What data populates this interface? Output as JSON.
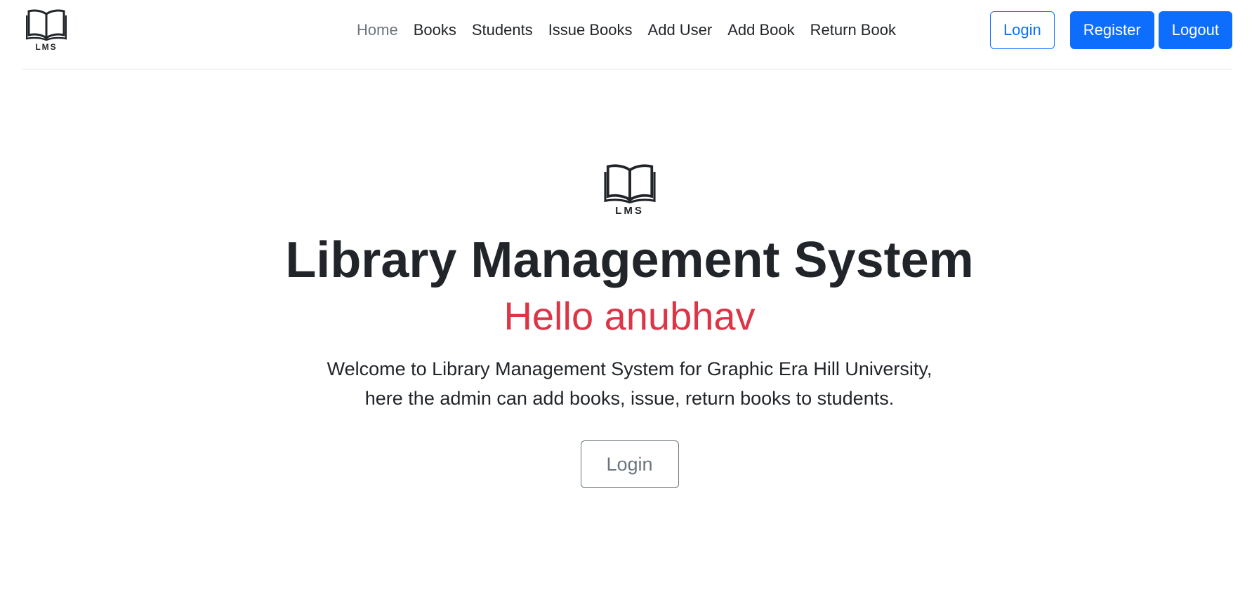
{
  "brand": {
    "logo_text": "LMS",
    "logo_icon": "open-book-icon"
  },
  "nav": {
    "items": [
      {
        "label": "Home",
        "active": true
      },
      {
        "label": "Books"
      },
      {
        "label": "Students"
      },
      {
        "label": "Issue Books"
      },
      {
        "label": "Add User"
      },
      {
        "label": "Add Book"
      },
      {
        "label": "Return Book"
      }
    ]
  },
  "auth": {
    "login_label": "Login",
    "register_label": "Register",
    "logout_label": "Logout"
  },
  "hero": {
    "logo_text": "LMS",
    "title": "Library Management System",
    "greeting": "Hello anubhav",
    "description": "Welcome to Library Management System for Graphic Era Hill University, here the admin can add books, issue, return books to students.",
    "login_label": "Login"
  },
  "colors": {
    "primary": "#0d6efd",
    "danger": "#dc3545",
    "secondary": "#6c757d",
    "text": "#212529"
  }
}
